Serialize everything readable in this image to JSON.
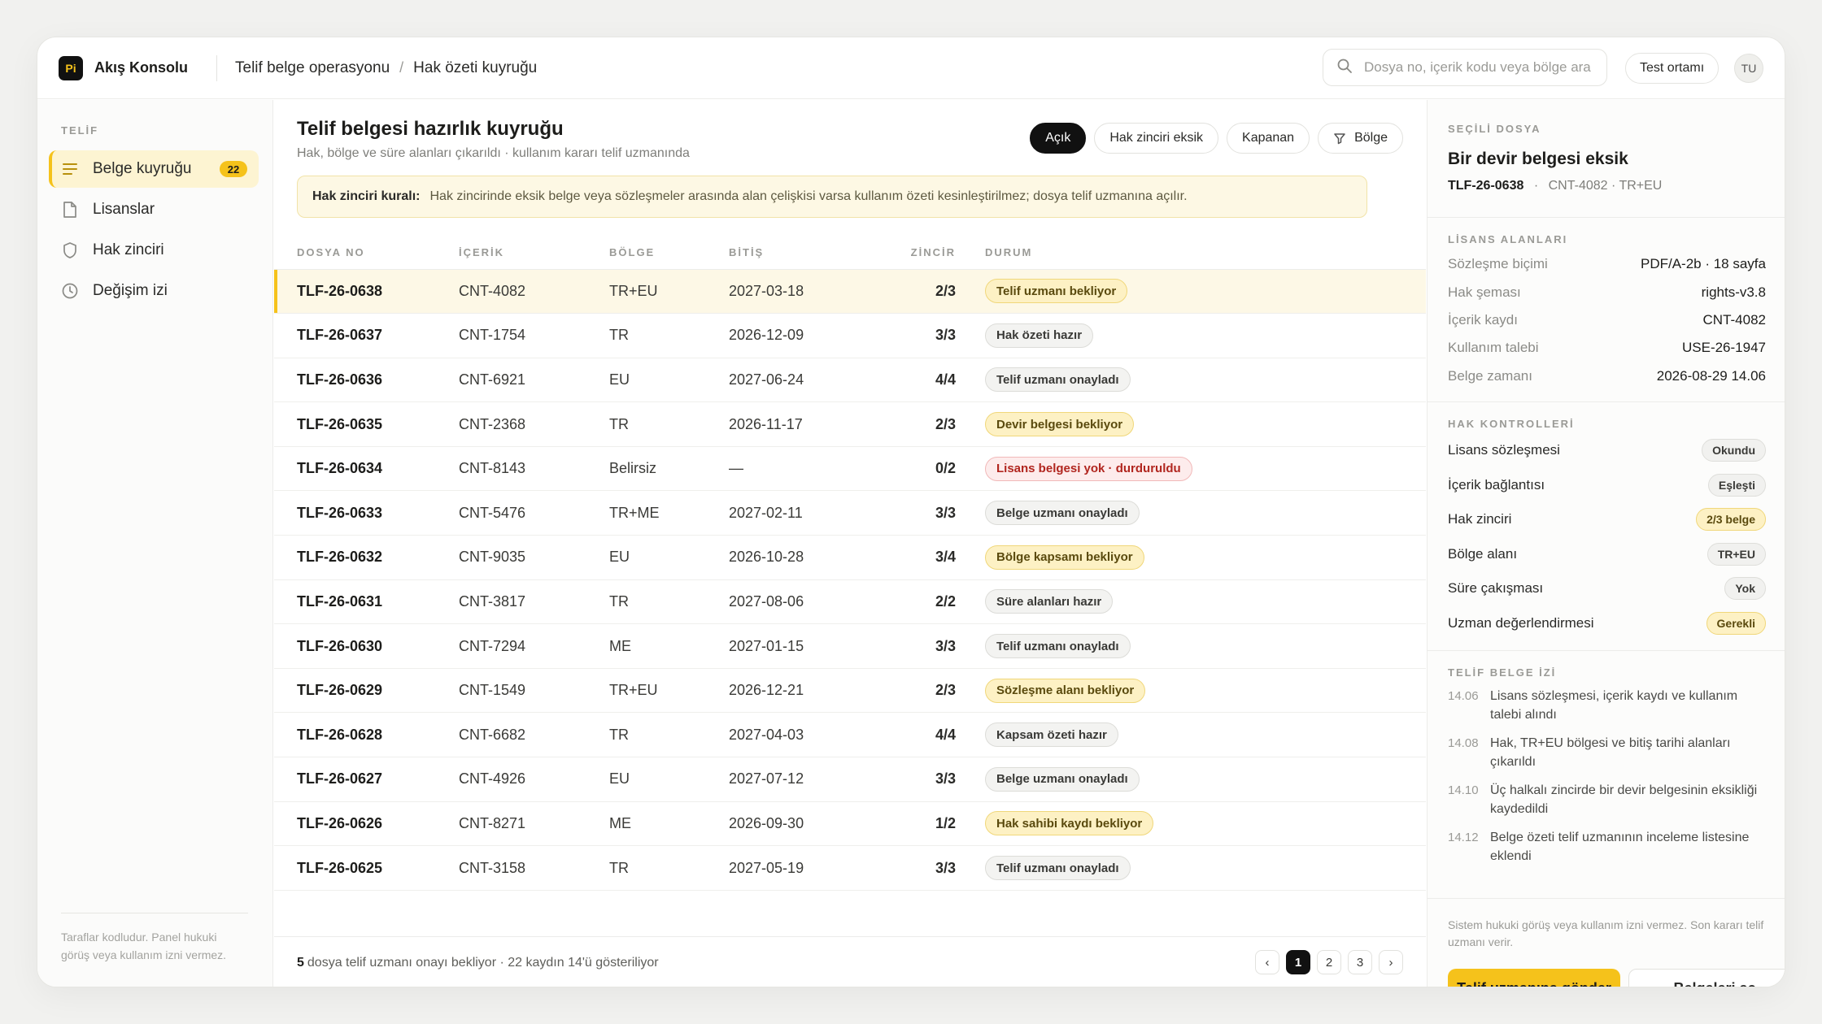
{
  "app": {
    "logo": "Pi",
    "name": "Akış Konsolu"
  },
  "breadcrumb": [
    "Telif belge operasyonu",
    "Hak özeti kuyruğu"
  ],
  "search": {
    "placeholder": "Dosya no, içerik kodu veya bölge ara"
  },
  "env": "Test ortamı",
  "user": "TU",
  "sidebar": {
    "heading": "TELİF",
    "items": [
      {
        "label": "Belge kuyruğu",
        "icon": "list-icon",
        "count": "22",
        "active": true
      },
      {
        "label": "Lisanslar",
        "icon": "file-icon"
      },
      {
        "label": "Hak zinciri",
        "icon": "shield-icon"
      },
      {
        "label": "Değişim izi",
        "icon": "clock-icon"
      }
    ],
    "footer": "Taraflar kodludur. Panel hukuki görüş veya kullanım izni vermez."
  },
  "main": {
    "title": "Telif belgesi hazırlık kuyruğu",
    "subtitle": "Hak, bölge ve süre alanları çıkarıldı · kullanım kararı telif uzmanında",
    "filters": [
      "Açık",
      "Hak zinciri eksik",
      "Kapanan",
      "Bölge"
    ],
    "rule": {
      "label": "Hak zinciri kuralı:",
      "text": "Hak zincirinde eksik belge veya sözleşmeler arasında alan çelişkisi varsa kullanım özeti kesinleştirilmez; dosya telif uzmanına açılır."
    },
    "columns": [
      "DOSYA NO",
      "İÇERİK",
      "BÖLGE",
      "BİTİŞ",
      "ZİNCİR",
      "DURUM"
    ],
    "rows": [
      {
        "id": "TLF-26-0638",
        "content": "CNT-4082",
        "region": "TR+EU",
        "end": "2027-03-18",
        "chain": "2/3",
        "status": "Telif uzmanı bekliyor",
        "tone": "yellow"
      },
      {
        "id": "TLF-26-0637",
        "content": "CNT-1754",
        "region": "TR",
        "end": "2026-12-09",
        "chain": "3/3",
        "status": "Hak özeti hazır",
        "tone": "gray"
      },
      {
        "id": "TLF-26-0636",
        "content": "CNT-6921",
        "region": "EU",
        "end": "2027-06-24",
        "chain": "4/4",
        "status": "Telif uzmanı onayladı",
        "tone": "gray"
      },
      {
        "id": "TLF-26-0635",
        "content": "CNT-2368",
        "region": "TR",
        "end": "2026-11-17",
        "chain": "2/3",
        "status": "Devir belgesi bekliyor",
        "tone": "yellow"
      },
      {
        "id": "TLF-26-0634",
        "content": "CNT-8143",
        "region": "Belirsiz",
        "end": "—",
        "chain": "0/2",
        "status": "Lisans belgesi yok · durduruldu",
        "tone": "red"
      },
      {
        "id": "TLF-26-0633",
        "content": "CNT-5476",
        "region": "TR+ME",
        "end": "2027-02-11",
        "chain": "3/3",
        "status": "Belge uzmanı onayladı",
        "tone": "gray"
      },
      {
        "id": "TLF-26-0632",
        "content": "CNT-9035",
        "region": "EU",
        "end": "2026-10-28",
        "chain": "3/4",
        "status": "Bölge kapsamı bekliyor",
        "tone": "yellow"
      },
      {
        "id": "TLF-26-0631",
        "content": "CNT-3817",
        "region": "TR",
        "end": "2027-08-06",
        "chain": "2/2",
        "status": "Süre alanları hazır",
        "tone": "gray"
      },
      {
        "id": "TLF-26-0630",
        "content": "CNT-7294",
        "region": "ME",
        "end": "2027-01-15",
        "chain": "3/3",
        "status": "Telif uzmanı onayladı",
        "tone": "gray"
      },
      {
        "id": "TLF-26-0629",
        "content": "CNT-1549",
        "region": "TR+EU",
        "end": "2026-12-21",
        "chain": "2/3",
        "status": "Sözleşme alanı bekliyor",
        "tone": "yellow"
      },
      {
        "id": "TLF-26-0628",
        "content": "CNT-6682",
        "region": "TR",
        "end": "2027-04-03",
        "chain": "4/4",
        "status": "Kapsam özeti hazır",
        "tone": "gray"
      },
      {
        "id": "TLF-26-0627",
        "content": "CNT-4926",
        "region": "EU",
        "end": "2027-07-12",
        "chain": "3/3",
        "status": "Belge uzmanı onayladı",
        "tone": "gray"
      },
      {
        "id": "TLF-26-0626",
        "content": "CNT-8271",
        "region": "ME",
        "end": "2026-09-30",
        "chain": "1/2",
        "status": "Hak sahibi kaydı bekliyor",
        "tone": "yellow"
      },
      {
        "id": "TLF-26-0625",
        "content": "CNT-3158",
        "region": "TR",
        "end": "2027-05-19",
        "chain": "3/3",
        "status": "Telif uzmanı onayladı",
        "tone": "gray"
      }
    ],
    "footer": {
      "count": "5",
      "text": "dosya telif uzmanı onayı bekliyor · 22 kaydın 14'ü gösteriliyor"
    },
    "pages": [
      "‹",
      "1",
      "2",
      "3",
      "›"
    ]
  },
  "panel": {
    "heading": "SEÇİLİ DOSYA",
    "title": "Bir devir belgesi eksik",
    "id": "TLF-26-0638",
    "meta": "CNT-4082 · TR+EU",
    "license_heading": "LİSANS ALANLARI",
    "license": [
      {
        "k": "Sözleşme biçimi",
        "v": "PDF/A-2b · 18 sayfa"
      },
      {
        "k": "Hak şeması",
        "v": "rights-v3.8"
      },
      {
        "k": "İçerik kaydı",
        "v": "CNT-4082"
      },
      {
        "k": "Kullanım talebi",
        "v": "USE-26-1947"
      },
      {
        "k": "Belge zamanı",
        "v": "2026-08-29 14.06"
      }
    ],
    "checks_heading": "HAK KONTROLLERİ",
    "checks": [
      {
        "k": "Lisans sözleşmesi",
        "v": "Okundu",
        "tone": "gray"
      },
      {
        "k": "İçerik bağlantısı",
        "v": "Eşleşti",
        "tone": "gray"
      },
      {
        "k": "Hak zinciri",
        "v": "2/3 belge",
        "tone": "yellow"
      },
      {
        "k": "Bölge alanı",
        "v": "TR+EU",
        "tone": "gray"
      },
      {
        "k": "Süre çakışması",
        "v": "Yok",
        "tone": "gray"
      },
      {
        "k": "Uzman değerlendirmesi",
        "v": "Gerekli",
        "tone": "yellow"
      }
    ],
    "log_heading": "TELİF BELGE İZİ",
    "log": [
      {
        "t": "14.06",
        "text": "Lisans sözleşmesi, içerik kaydı ve kullanım talebi alındı"
      },
      {
        "t": "14.08",
        "text": "Hak, TR+EU bölgesi ve bitiş tarihi alanları çıkarıldı"
      },
      {
        "t": "14.10",
        "text": "Üç halkalı zincirde bir devir belgesinin eksikliği kaydedildi"
      },
      {
        "t": "14.12",
        "text": "Belge özeti telif uzmanının inceleme listesine eklendi"
      }
    ],
    "note": "Sistem hukuki görüş veya kullanım izni vermez. Son kararı telif uzmanı verir.",
    "primary": "Telif uzmanına gönder",
    "secondary": "Belgeleri aç"
  },
  "colors": {
    "accent": "#f5c21b",
    "dark": "#111111",
    "danger": "#b1261f"
  }
}
